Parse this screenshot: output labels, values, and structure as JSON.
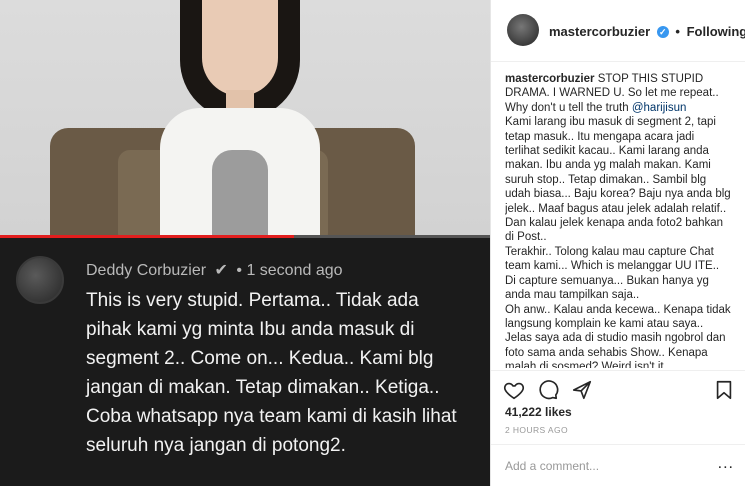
{
  "video": {
    "progress": 0.6
  },
  "yt_comment": {
    "author": "Deddy Corbuzier",
    "check_icon": "✔",
    "separator": "•",
    "time": "1 second ago",
    "body": "This is very stupid. Pertama.. Tidak ada pihak kami yg minta Ibu anda masuk di segment 2.. Come on... Kedua.. Kami blg jangan di makan. Tetap dimakan.. Ketiga.. Coba whatsapp nya team kami di kasih lihat seluruh nya jangan di potong2."
  },
  "ig": {
    "username": "mastercorbuzier",
    "verified_icon": "✓",
    "dot": "•",
    "follow_status": "Following",
    "more_icon": "...",
    "caption": {
      "author": "mastercorbuzier",
      "line1": "STOP THIS STUPID DRAMA. I WARNED U. So let me repeat.. Why don't u tell the truth",
      "mention": "@harijisun",
      "p1": "Kami larang ibu masuk di segment 2, tapi tetap masuk.. Itu mengapa acara jadi terlihat sedikit kacau.. Kami larang anda makan. Ibu anda yg malah makan. Kami suruh stop.. Tetap dimakan.. Sambil blg udah biasa... Baju korea? Baju nya anda blg jelek.. Maaf bagus atau jelek adalah relatif.. Dan kalau jelek kenapa anda foto2 bahkan di Post..",
      "p2": "Terakhir.. Tolong kalau mau capture Chat team kami... Which is melanggar UU ITE.. Di capture semuanya... Bukan hanya yg anda mau tampilkan saja..",
      "p3": "Oh anw.. Kalau anda kecewa.. Kenapa tidak langsung komplain ke kami atau saya.. Jelas saya ada di studio masih ngobrol dan foto sama anda sehabis Show.. Kenapa malah di sosmed? Weird isn't it"
    },
    "likes": "41,222 likes",
    "time": "2 HOURS AGO",
    "comment_placeholder": "Add a comment...",
    "icons": [
      "heart-icon",
      "comment-icon",
      "share-icon",
      "bookmark-icon"
    ]
  }
}
